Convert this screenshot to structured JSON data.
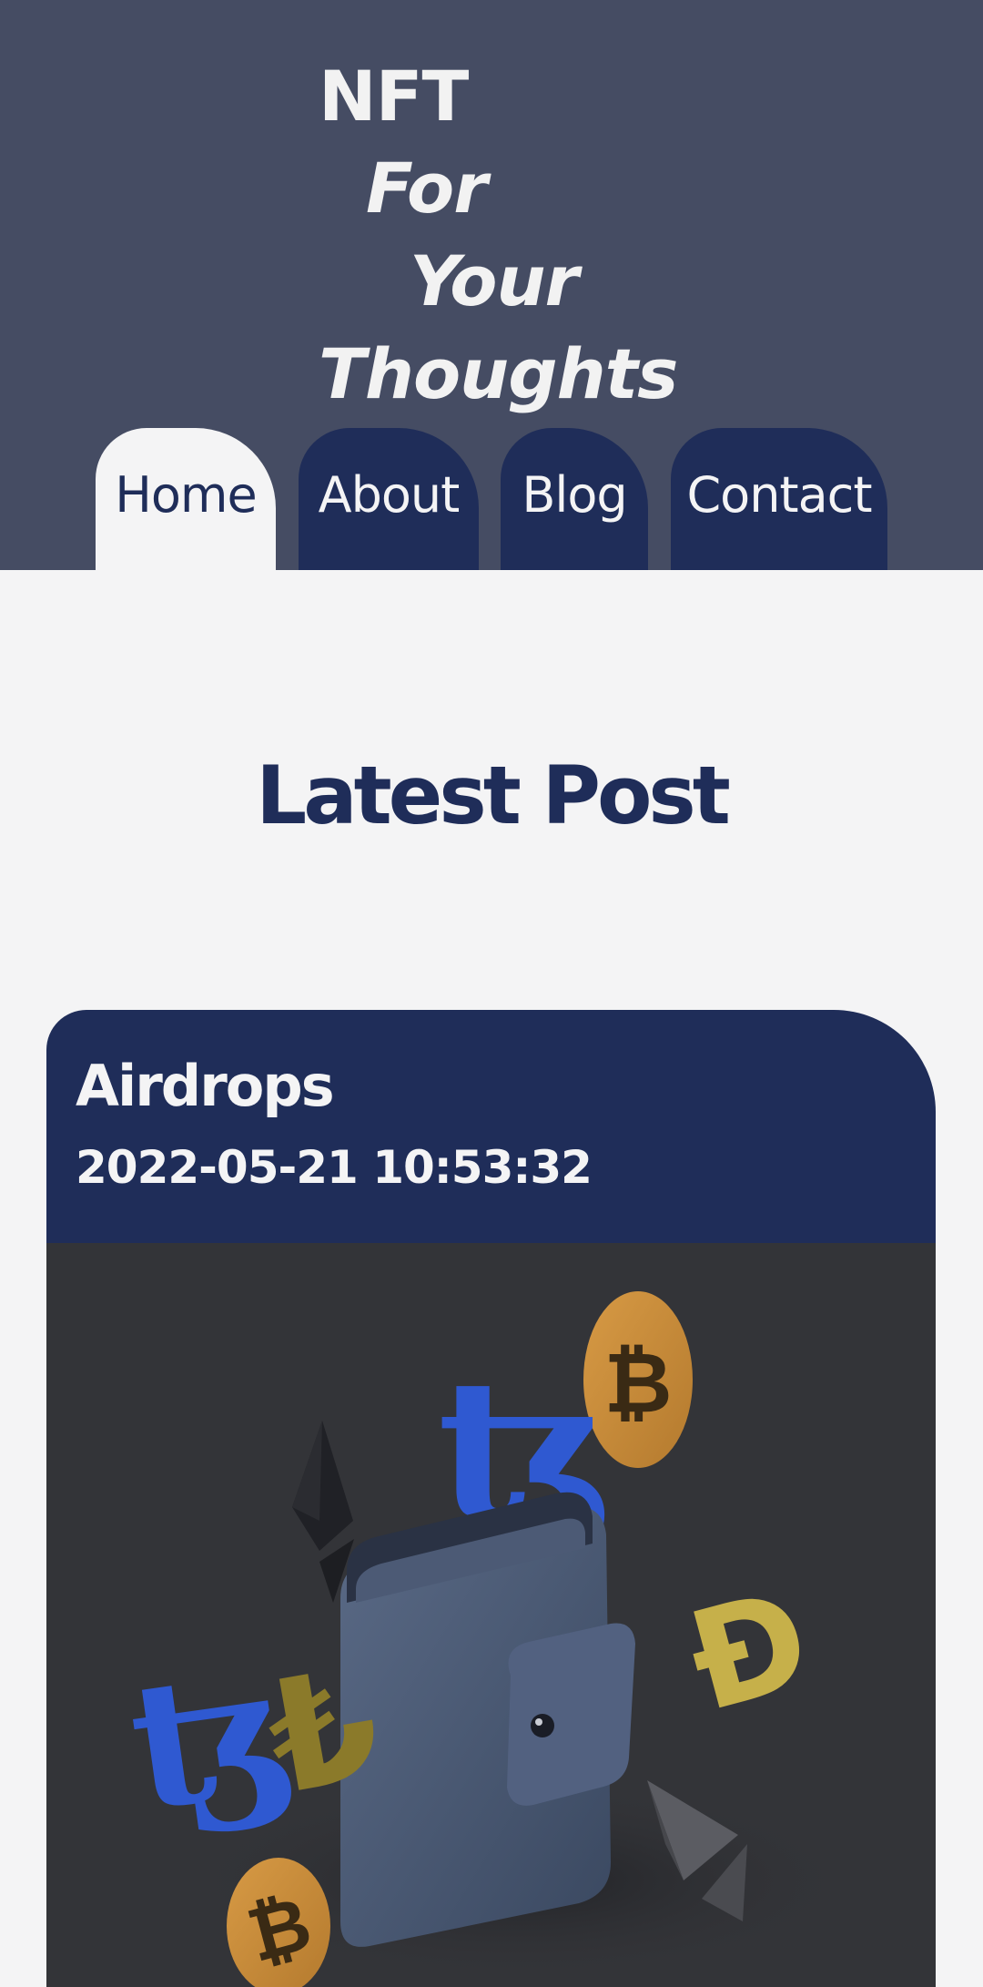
{
  "header": {
    "logo_lines": [
      "NFT",
      "For",
      "Your",
      "Thoughts"
    ]
  },
  "nav": {
    "tabs": [
      {
        "label": "Home",
        "active": true
      },
      {
        "label": "About",
        "active": false
      },
      {
        "label": "Blog",
        "active": false
      },
      {
        "label": "Contact",
        "active": false
      }
    ]
  },
  "main": {
    "section_title": "Latest Post",
    "post": {
      "title": "Airdrops",
      "date": "2022-05-21 10:53:32",
      "image_icon": "crypto-wallet-illustration"
    }
  },
  "colors": {
    "header_bg": "#454c63",
    "navy": "#1f2d59",
    "page_bg": "#f4f4f5",
    "image_bg": "#333438",
    "coin_gold": "#c98a3a",
    "tezos_blue": "#2f59d1"
  }
}
